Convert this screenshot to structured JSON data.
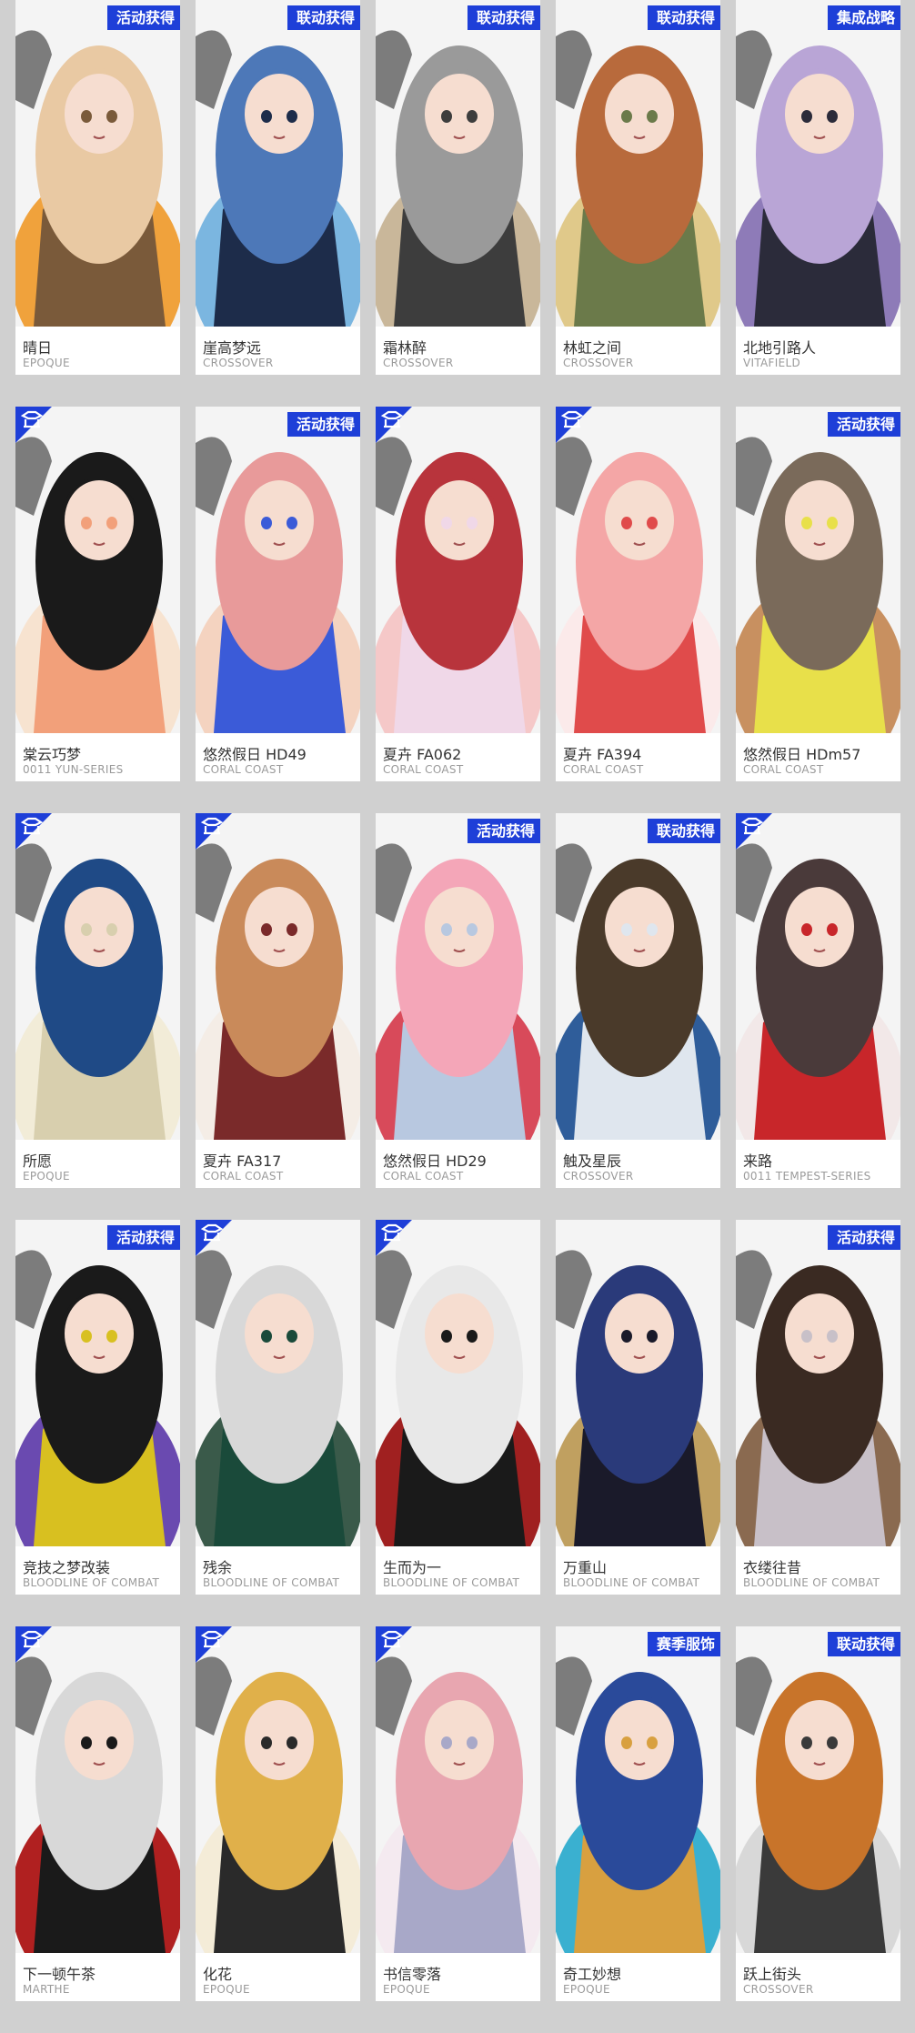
{
  "colors": {
    "tag_bg": "#1e3fd8",
    "page_bg": "#d0d0d0"
  },
  "cards": [
    {
      "name": "晴日",
      "series": "EPOQUE",
      "tag": "活动获得",
      "badge": false,
      "c1": "#e9c9a3",
      "c2": "#7a5a3a",
      "c3": "#f0a23c"
    },
    {
      "name": "崖高梦远",
      "series": "CROSSOVER",
      "tag": "联动获得",
      "badge": false,
      "c1": "#4d78b8",
      "c2": "#1d2c4a",
      "c3": "#7bb6e0"
    },
    {
      "name": "霜林醉",
      "series": "CROSSOVER",
      "tag": "联动获得",
      "badge": false,
      "c1": "#9a9a9a",
      "c2": "#3d3d3d",
      "c3": "#c9b79a"
    },
    {
      "name": "林虹之间",
      "series": "CROSSOVER",
      "tag": "联动获得",
      "badge": false,
      "c1": "#b86a3c",
      "c2": "#6b7a4a",
      "c3": "#e0c98a"
    },
    {
      "name": "北地引路人",
      "series": "VITAFIELD",
      "tag": "集成战略",
      "badge": false,
      "c1": "#b9a5d6",
      "c2": "#2b2b3a",
      "c3": "#8e7bb8"
    },
    {
      "name": "棠云巧梦",
      "series": "0011 YUN-SERIES",
      "tag": "",
      "badge": true,
      "c1": "#1a1a1a",
      "c2": "#f2a07a",
      "c3": "#f7e3d0"
    },
    {
      "name": "悠然假日 HD49",
      "series": "CORAL COAST",
      "tag": "活动获得",
      "badge": false,
      "c1": "#e89a9a",
      "c2": "#3b5bd8",
      "c3": "#f4d3c0"
    },
    {
      "name": "夏卉 FA062",
      "series": "CORAL COAST",
      "tag": "",
      "badge": true,
      "c1": "#b8343c",
      "c2": "#f0d8e8",
      "c3": "#f5c8c8"
    },
    {
      "name": "夏卉 FA394",
      "series": "CORAL COAST",
      "tag": "",
      "badge": true,
      "c1": "#f4a6a6",
      "c2": "#e04b4b",
      "c3": "#fbeaea"
    },
    {
      "name": "悠然假日 HDm57",
      "series": "CORAL COAST",
      "tag": "活动获得",
      "badge": false,
      "c1": "#7a6a5a",
      "c2": "#e8e04a",
      "c3": "#c89060"
    },
    {
      "name": "所愿",
      "series": "EPOQUE",
      "tag": "",
      "badge": true,
      "c1": "#1f4a86",
      "c2": "#d8cfae",
      "c3": "#f2ecd8"
    },
    {
      "name": "夏卉 FA317",
      "series": "CORAL COAST",
      "tag": "",
      "badge": true,
      "c1": "#c98a5a",
      "c2": "#7a2a2a",
      "c3": "#f4ede6"
    },
    {
      "name": "悠然假日 HD29",
      "series": "CORAL COAST",
      "tag": "活动获得",
      "badge": false,
      "c1": "#f4a6b8",
      "c2": "#b8c8e0",
      "c3": "#d84a5a"
    },
    {
      "name": "触及星辰",
      "series": "CROSSOVER",
      "tag": "联动获得",
      "badge": false,
      "c1": "#4a3a2a",
      "c2": "#dfe6ee",
      "c3": "#2f5d9a"
    },
    {
      "name": "来路",
      "series": "0011 TEMPEST-SERIES",
      "tag": "",
      "badge": true,
      "c1": "#4a3a3a",
      "c2": "#c8262a",
      "c3": "#f2e8e8"
    },
    {
      "name": "竞技之梦改装",
      "series": "BLOODLINE OF COMBAT",
      "tag": "活动获得",
      "badge": false,
      "c1": "#1a1a1a",
      "c2": "#d8c020",
      "c3": "#6a4ab0"
    },
    {
      "name": "残余",
      "series": "BLOODLINE OF COMBAT",
      "tag": "",
      "badge": true,
      "c1": "#d8d8d8",
      "c2": "#1a4a3a",
      "c3": "#3a5a4a"
    },
    {
      "name": "生而为一",
      "series": "BLOODLINE OF COMBAT",
      "tag": "",
      "badge": true,
      "c1": "#e8e8e8",
      "c2": "#1a1a1a",
      "c3": "#a02020"
    },
    {
      "name": "万重山",
      "series": "BLOODLINE OF COMBAT",
      "tag": "",
      "badge": false,
      "c1": "#2a3a7a",
      "c2": "#1a1a2a",
      "c3": "#c0a060"
    },
    {
      "name": "衣缕往昔",
      "series": "BLOODLINE OF COMBAT",
      "tag": "活动获得",
      "badge": false,
      "c1": "#3a2a22",
      "c2": "#c8c0c8",
      "c3": "#8a6a50"
    },
    {
      "name": "下一顿午茶",
      "series": "MARTHE",
      "tag": "",
      "badge": true,
      "c1": "#d8d8d8",
      "c2": "#1a1a1a",
      "c3": "#b02020"
    },
    {
      "name": "化花",
      "series": "EPOQUE",
      "tag": "",
      "badge": true,
      "c1": "#e0b04a",
      "c2": "#2a2a2a",
      "c3": "#f4ecd8"
    },
    {
      "name": "书信零落",
      "series": "EPOQUE",
      "tag": "",
      "badge": true,
      "c1": "#e8a6b0",
      "c2": "#a8a8c8",
      "c3": "#f4eaf0"
    },
    {
      "name": "奇工妙想",
      "series": "EPOQUE",
      "tag": "赛季服饰",
      "badge": false,
      "c1": "#2a4a9a",
      "c2": "#d8a040",
      "c3": "#3ab0d0"
    },
    {
      "name": "跃上街头",
      "series": "CROSSOVER",
      "tag": "联动获得",
      "badge": false,
      "c1": "#c8742a",
      "c2": "#3a3a3a",
      "c3": "#d8d8d8"
    }
  ]
}
